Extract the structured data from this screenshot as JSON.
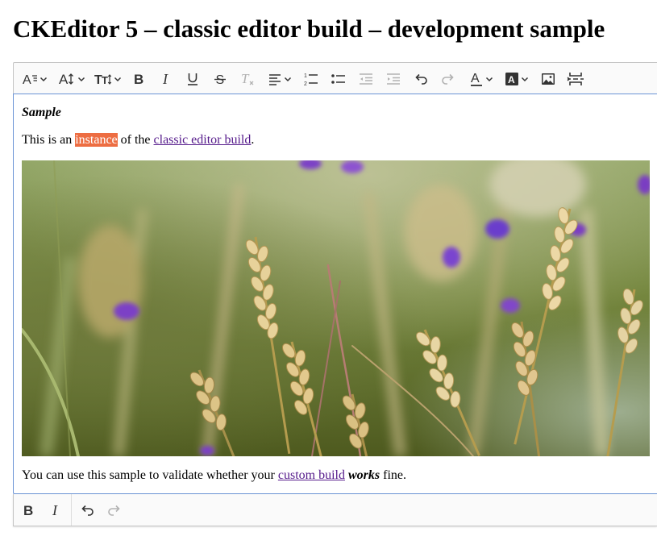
{
  "page": {
    "title": "CKEditor 5 – classic editor build – development sample"
  },
  "toolbar": {
    "buttons": [
      {
        "name": "heading-dropdown",
        "icon": "heading-icon",
        "dropdown": true
      },
      {
        "name": "font-size-dropdown",
        "icon": "font-size-icon",
        "dropdown": true
      },
      {
        "name": "font-family-dropdown",
        "icon": "font-family-icon",
        "dropdown": true
      },
      {
        "name": "bold-button",
        "icon": "bold-icon"
      },
      {
        "name": "italic-button",
        "icon": "italic-icon"
      },
      {
        "name": "underline-button",
        "icon": "underline-icon"
      },
      {
        "name": "strikethrough-button",
        "icon": "strikethrough-icon"
      },
      {
        "name": "remove-format-button",
        "icon": "remove-format-icon",
        "disabled": true
      },
      {
        "name": "alignment-dropdown",
        "icon": "align-left-icon",
        "dropdown": true
      },
      {
        "name": "numbered-list-button",
        "icon": "numbered-list-icon"
      },
      {
        "name": "bulleted-list-button",
        "icon": "bulleted-list-icon"
      },
      {
        "name": "outdent-button",
        "icon": "outdent-icon",
        "disabled": true
      },
      {
        "name": "indent-button",
        "icon": "indent-icon",
        "disabled": true
      },
      {
        "name": "undo-button",
        "icon": "undo-icon"
      },
      {
        "name": "redo-button",
        "icon": "redo-icon",
        "disabled": true
      },
      {
        "name": "font-color-dropdown",
        "icon": "font-color-icon",
        "dropdown": true
      },
      {
        "name": "font-background-dropdown",
        "icon": "font-background-icon",
        "dropdown": true
      },
      {
        "name": "insert-image-button",
        "icon": "image-icon"
      },
      {
        "name": "page-break-button",
        "icon": "page-break-icon"
      }
    ]
  },
  "content": {
    "heading": "Sample",
    "intro_before": "This is an ",
    "intro_highlight": "instance",
    "intro_middle": " of the ",
    "intro_link": "classic editor build",
    "intro_after": ".",
    "image_alt": "wheat field with purple flowers",
    "outro_before": "You can use this sample to validate whether your ",
    "outro_link": "custom build",
    "outro_space": " ",
    "outro_emphasis": "works",
    "outro_after": " fine."
  },
  "bottom_toolbar": {
    "buttons": [
      {
        "name": "bold-button",
        "icon": "bold-icon"
      },
      {
        "name": "italic-button",
        "icon": "italic-icon"
      },
      {
        "name": "undo-button",
        "icon": "undo-icon"
      },
      {
        "name": "redo-button",
        "icon": "redo-icon",
        "disabled": true
      }
    ]
  },
  "colors": {
    "highlight_bg": "#ed6d42",
    "highlight_text": "#ffffff",
    "link": "#551a8b",
    "focus_border": "#6b94d6",
    "toolbar_bg": "#fafafa"
  }
}
